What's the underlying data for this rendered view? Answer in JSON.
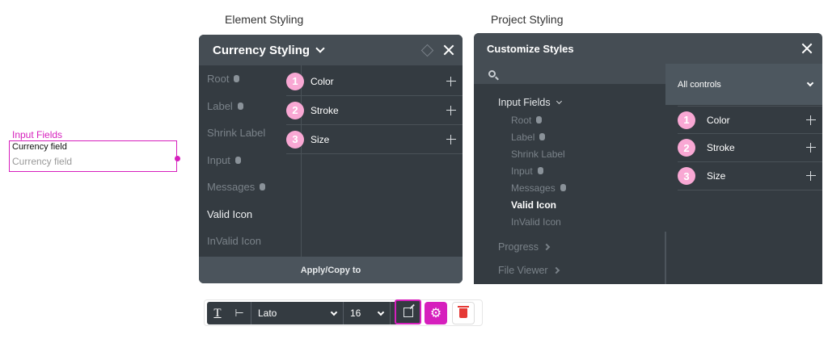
{
  "captions": {
    "element": "Element Styling",
    "project": "Project Styling"
  },
  "canvas": {
    "label": "Input Fields",
    "value": "Currency field",
    "placeholder": "Currency field"
  },
  "element_panel": {
    "title": "Currency Styling",
    "list": [
      {
        "label": "Root",
        "info": true,
        "active": false
      },
      {
        "label": "Label",
        "info": true,
        "active": false
      },
      {
        "label": "Shrink Label",
        "info": false,
        "active": false
      },
      {
        "label": "Input",
        "info": true,
        "active": false
      },
      {
        "label": "Messages",
        "info": true,
        "active": false
      },
      {
        "label": "Valid Icon",
        "info": false,
        "active": true
      },
      {
        "label": "InValid Icon",
        "info": false,
        "active": false
      }
    ],
    "controls": [
      {
        "num": "1",
        "label": "Color"
      },
      {
        "num": "2",
        "label": "Stroke"
      },
      {
        "num": "3",
        "label": "Size"
      }
    ],
    "apply_label": "Apply/Copy to"
  },
  "project_panel": {
    "title": "Customize Styles",
    "filter": "All controls",
    "tree_head": "Input Fields",
    "tree_items": [
      {
        "label": "Root",
        "info": true,
        "active": false
      },
      {
        "label": "Label",
        "info": true,
        "active": false
      },
      {
        "label": "Shrink Label",
        "info": false,
        "active": false
      },
      {
        "label": "Input",
        "info": true,
        "active": false
      },
      {
        "label": "Messages",
        "info": true,
        "active": false
      },
      {
        "label": "Valid Icon",
        "info": false,
        "active": true
      },
      {
        "label": "InValid Icon",
        "info": false,
        "active": false
      }
    ],
    "groups": [
      "Progress",
      "File Viewer"
    ],
    "controls": [
      {
        "num": "1",
        "label": "Color"
      },
      {
        "num": "2",
        "label": "Stroke"
      },
      {
        "num": "3",
        "label": "Size"
      }
    ]
  },
  "toolbar": {
    "text_icon": "T",
    "indent_icon": "⊢",
    "font": "Lato",
    "size": "16"
  },
  "colors": {
    "accent": "#d61fbd",
    "panel_bg": "#343b41",
    "badge": "#f9a8d4"
  }
}
